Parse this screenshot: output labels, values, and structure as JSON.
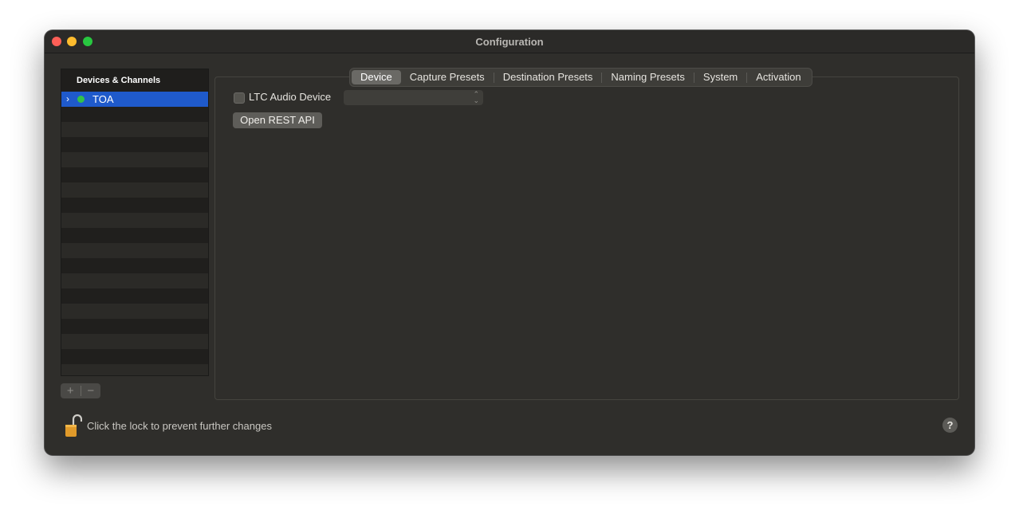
{
  "window": {
    "title": "Configuration"
  },
  "sidebar": {
    "header": "Devices & Channels",
    "items": [
      {
        "label": "TOA",
        "status_color": "#32c24a",
        "selected": true
      }
    ],
    "add_label": "+",
    "remove_label": "−"
  },
  "tabs": [
    {
      "label": "Device",
      "active": true
    },
    {
      "label": "Capture Presets"
    },
    {
      "label": "Destination Presets"
    },
    {
      "label": "Naming Presets"
    },
    {
      "label": "System"
    },
    {
      "label": "Activation"
    }
  ],
  "device": {
    "ltc_label": "LTC Audio Device",
    "ltc_checked": false,
    "ltc_select_value": "",
    "rest_button": "Open REST API"
  },
  "footer": {
    "lock_text": "Click the lock to prevent further changes",
    "help_label": "?"
  },
  "colors": {
    "accent": "#1f5acb",
    "status_ok": "#32c24a"
  }
}
